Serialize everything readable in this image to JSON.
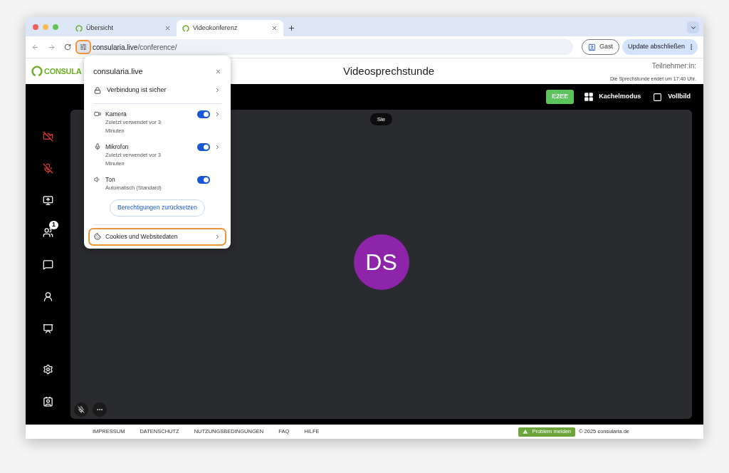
{
  "tabs": [
    {
      "label": "Übersicht",
      "selected": false
    },
    {
      "label": "Videokonferenz",
      "selected": true
    }
  ],
  "address_bar": {
    "url_host": "consularia.live",
    "url_path": "/conference/",
    "profile": "Gast",
    "update_button": "Update abschließen"
  },
  "site_header": {
    "logo": "CONSULA",
    "title": "Videosprechstunde",
    "participants_label": "Teilnehmer:in:",
    "session_end": "Die Sprechstunde endet um 17:40 Uhr."
  },
  "toolbar": {
    "e2ee": "E2EE",
    "tile_mode": "Kachelmodus",
    "fullscreen": "Vollbild"
  },
  "sidebar": [
    {
      "kind": "camera",
      "muted": true
    },
    {
      "kind": "mic",
      "muted": true
    },
    {
      "kind": "screen",
      "muted": false
    },
    {
      "kind": "participants",
      "muted": false,
      "badge": "1"
    },
    {
      "kind": "chat",
      "muted": false
    },
    {
      "kind": "waiting",
      "muted": false
    },
    {
      "kind": "whiteboard",
      "muted": false
    },
    {
      "kind": "settings",
      "muted": false
    },
    {
      "kind": "switch",
      "muted": false
    }
  ],
  "video": {
    "self_label": "Sie",
    "avatar": "DS"
  },
  "site_popup": {
    "title": "consularia.live",
    "connection": "Verbindung ist sicher",
    "permissions": [
      {
        "kind": "camera",
        "name": "Kamera",
        "detail": "Zuletzt verwendet vor 3 Minuten",
        "on": true,
        "chevron": true
      },
      {
        "kind": "mic",
        "name": "Mikrofon",
        "detail": "Zuletzt verwendet vor 3 Minuten",
        "on": true,
        "chevron": true
      },
      {
        "kind": "sound",
        "name": "Ton",
        "detail": "Automatisch (Standard)",
        "on": true,
        "chevron": false
      }
    ],
    "reset_button": "Berechtigungen zurücksetzen",
    "cookies": "Cookies und Websitedaten"
  },
  "footer": {
    "links": [
      "IMPRESSUM",
      "DATENSCHUTZ",
      "NUTZUNGSBEDINGUNGEN",
      "FAQ",
      "HILFE"
    ],
    "report_button": "Problem melden",
    "copyright": "© 2025 consularia.de"
  }
}
